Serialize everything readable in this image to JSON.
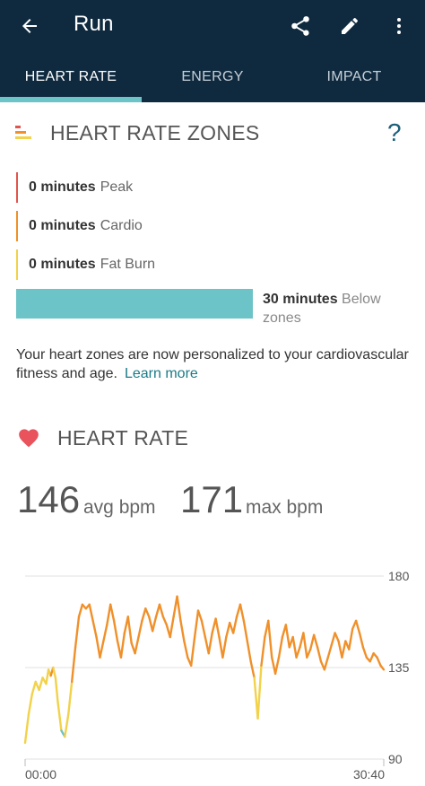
{
  "app": {
    "title": "Run",
    "actions": [
      "share-icon",
      "edit-icon",
      "more-icon"
    ],
    "tabs": [
      {
        "label": "HEART RATE",
        "active": true
      },
      {
        "label": "ENERGY",
        "active": false
      },
      {
        "label": "IMPACT",
        "active": false
      }
    ]
  },
  "zones": {
    "title": "HEART RATE ZONES",
    "help": "?",
    "rows": [
      {
        "value": "0 minutes",
        "label": "Peak",
        "color": "#e0554e"
      },
      {
        "value": "0 minutes",
        "label": "Cardio",
        "color": "#f0902a"
      },
      {
        "value": "0 minutes",
        "label": "Fat Burn",
        "color": "#f2d24a"
      }
    ],
    "below": {
      "value": "30 minutes",
      "label": "Below zones",
      "color": "#6cc3c8"
    },
    "info": "Your heart zones are now personalized to your cardiovascular fitness and age.",
    "learn_more": "Learn more"
  },
  "heart_rate": {
    "title": "HEART RATE",
    "avg": "146",
    "avg_unit": "avg bpm",
    "max": "171",
    "max_unit": "max bpm"
  },
  "chart_data": {
    "type": "line",
    "title": "",
    "xlabel": "",
    "ylabel": "",
    "x_ticks": [
      "00:00",
      "30:40"
    ],
    "y_ticks": [
      180,
      135,
      90
    ],
    "ylim": [
      90,
      180
    ],
    "x_range_min": [
      0,
      30.67
    ],
    "zone_colors": {
      "below": "#6cc3c8",
      "fat_burn": "#f2d24a",
      "cardio": "#f0902a",
      "peak": "#e0554e"
    },
    "series": [
      {
        "x": [
          0,
          0.3,
          0.6,
          0.9,
          1.2,
          1.5,
          1.8,
          2.0,
          2.2,
          2.4,
          2.6,
          2.8,
          3.1,
          3.4,
          3.7,
          4.0,
          4.3,
          4.6,
          4.9,
          5.2,
          5.5,
          5.8,
          6.1,
          6.4,
          6.7,
          7.0,
          7.3,
          7.6,
          7.9,
          8.2,
          8.5,
          8.8,
          9.1,
          9.4,
          9.7,
          10.0,
          10.3,
          10.6,
          10.9,
          11.2,
          11.5,
          11.8,
          12.1,
          12.4,
          12.7,
          13.0,
          13.3,
          13.6,
          13.9,
          14.2,
          14.5,
          14.8,
          15.1,
          15.4,
          15.7,
          16.0,
          16.3,
          16.6,
          16.9,
          17.2,
          17.5,
          17.8,
          18.1,
          18.4,
          18.7,
          19.0,
          19.3,
          19.6,
          19.9,
          20.2,
          20.5,
          20.8,
          21.1,
          21.4,
          21.7,
          22.0,
          22.3,
          22.6,
          22.9,
          23.2,
          23.5,
          23.8,
          24.1,
          24.4,
          24.7,
          25.0,
          25.3,
          25.6,
          25.9,
          26.2,
          26.5,
          26.8,
          27.1,
          27.4,
          27.7,
          28.0,
          28.3,
          28.6,
          28.9,
          29.2,
          29.5,
          29.8,
          30.1,
          30.4,
          30.67
        ],
        "y": [
          98,
          112,
          122,
          128,
          124,
          130,
          127,
          134,
          131,
          135,
          130,
          118,
          104,
          101,
          112,
          128,
          145,
          160,
          166,
          164,
          166,
          158,
          150,
          140,
          148,
          156,
          166,
          158,
          148,
          140,
          152,
          160,
          147,
          142,
          150,
          158,
          164,
          160,
          153,
          160,
          166,
          160,
          156,
          150,
          160,
          170,
          158,
          148,
          140,
          136,
          150,
          163,
          158,
          150,
          142,
          152,
          159,
          150,
          140,
          150,
          157,
          152,
          160,
          166,
          158,
          148,
          138,
          130,
          110,
          136,
          150,
          158,
          140,
          132,
          140,
          150,
          156,
          145,
          150,
          140,
          145,
          152,
          140,
          144,
          151,
          145,
          138,
          134,
          140,
          146,
          152,
          148,
          140,
          148,
          144,
          154,
          158,
          152,
          145,
          140,
          138,
          142,
          140,
          136,
          134
        ]
      }
    ]
  }
}
